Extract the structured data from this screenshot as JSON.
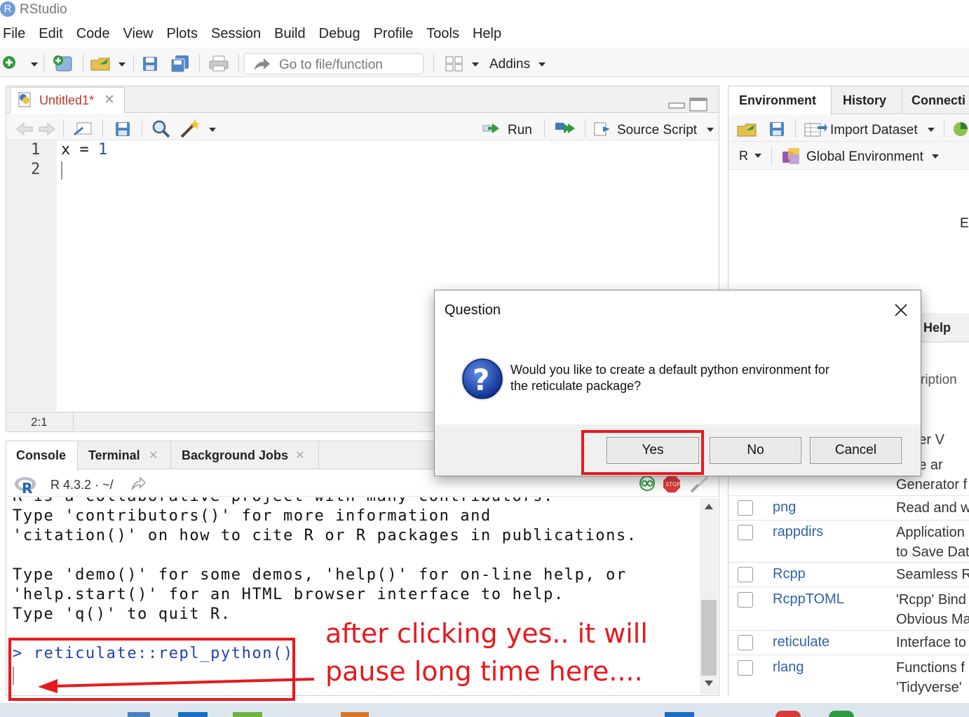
{
  "app": {
    "icon_letter": "R",
    "title": "RStudio"
  },
  "menu": [
    "File",
    "Edit",
    "Code",
    "View",
    "Plots",
    "Session",
    "Build",
    "Debug",
    "Profile",
    "Tools",
    "Help"
  ],
  "toolbar": {
    "goto_placeholder": "Go to file/function",
    "addins_label": "Addins"
  },
  "editor": {
    "tab_label": "Untitled1*",
    "run_label": "Run",
    "source_label": "Source Script",
    "line_numbers": [
      "1",
      "2"
    ],
    "code_var": "x",
    "code_op": "=",
    "code_num": "1",
    "cursor_pos": "2:1"
  },
  "env_pane": {
    "tabs": [
      "Environment",
      "History",
      "Connecti"
    ],
    "import_label": "Import Dataset",
    "lang_label": "R",
    "scope_label": "Global Environment",
    "empty_fragment": "E"
  },
  "pkg_pane": {
    "help_tab": "Help",
    "desc_header_fragment": "ription",
    "partial_rows": [
      "mpler V",
      "mple ar",
      "Generator f"
    ],
    "rows": [
      {
        "name": "png",
        "desc": [
          "Read and w"
        ]
      },
      {
        "name": "rappdirs",
        "desc": [
          "Application",
          "to Save Dat"
        ]
      },
      {
        "name": "Rcpp",
        "desc": [
          "Seamless R"
        ]
      },
      {
        "name": "RcppTOML",
        "desc": [
          "'Rcpp' Bind",
          "Obvious Ma"
        ]
      },
      {
        "name": "reticulate",
        "desc": [
          "Interface to"
        ]
      },
      {
        "name": "rlang",
        "desc": [
          "Functions f",
          "'Tidyverse'"
        ]
      }
    ]
  },
  "console": {
    "tabs": [
      "Console",
      "Terminal",
      "Background Jobs"
    ],
    "version": "R 4.3.2",
    "dot": "·",
    "path": "~/",
    "lines": [
      "R is a collaborative project with many contributors.",
      "Type 'contributors()' for more information and",
      "'citation()' on how to cite R or R packages in publications.",
      "",
      "Type 'demo()' for some demos, 'help()' for on-line help, or",
      "'help.start()' for an HTML browser interface to help.",
      "Type 'q()' to quit R."
    ],
    "prompt": ">",
    "command": "reticulate::repl_python()"
  },
  "dialog": {
    "title": "Question",
    "message_line1": "Would you like to create a default python environment for",
    "message_line2": "the reticulate package?",
    "yes": "Yes",
    "no": "No",
    "cancel": "Cancel"
  },
  "annotation": {
    "line1": "after clicking yes.. it will",
    "line2": "pause long time here....",
    "color": "#e8191d"
  }
}
